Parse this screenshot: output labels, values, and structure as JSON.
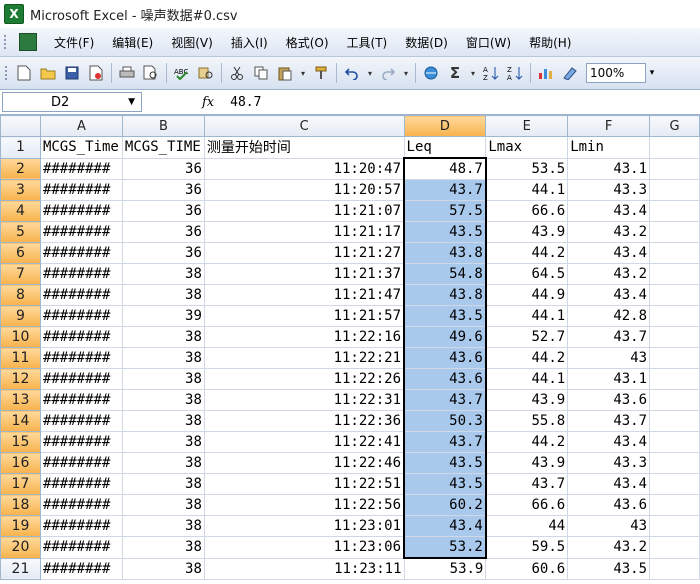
{
  "window": {
    "title": "Microsoft Excel - 噪声数据#0.csv",
    "app_icon": "excel-icon"
  },
  "menu": [
    "文件(F)",
    "编辑(E)",
    "视图(V)",
    "插入(I)",
    "格式(O)",
    "工具(T)",
    "数据(D)",
    "窗口(W)",
    "帮助(H)"
  ],
  "toolbar": {
    "zoom": "100%",
    "autosum": "Σ"
  },
  "formula": {
    "name_box": "D2",
    "fx": "fx",
    "value": "48.7"
  },
  "columns": [
    "A",
    "B",
    "C",
    "D",
    "E",
    "F",
    "G"
  ],
  "header_row": [
    "MCGS_Time",
    "MCGS_TIME",
    "测量开始时间",
    "Leq",
    "Lmax",
    "Lmin",
    ""
  ],
  "rows": [
    {
      "n": "1"
    },
    {
      "n": "2",
      "a": "########",
      "b": "36",
      "c": "11:20:47",
      "d": "48.7",
      "e": "53.5",
      "f": "43.1"
    },
    {
      "n": "3",
      "a": "########",
      "b": "36",
      "c": "11:20:57",
      "d": "43.7",
      "e": "44.1",
      "f": "43.3"
    },
    {
      "n": "4",
      "a": "########",
      "b": "36",
      "c": "11:21:07",
      "d": "57.5",
      "e": "66.6",
      "f": "43.4"
    },
    {
      "n": "5",
      "a": "########",
      "b": "36",
      "c": "11:21:17",
      "d": "43.5",
      "e": "43.9",
      "f": "43.2"
    },
    {
      "n": "6",
      "a": "########",
      "b": "36",
      "c": "11:21:27",
      "d": "43.8",
      "e": "44.2",
      "f": "43.4"
    },
    {
      "n": "7",
      "a": "########",
      "b": "38",
      "c": "11:21:37",
      "d": "54.8",
      "e": "64.5",
      "f": "43.2"
    },
    {
      "n": "8",
      "a": "########",
      "b": "38",
      "c": "11:21:47",
      "d": "43.8",
      "e": "44.9",
      "f": "43.4"
    },
    {
      "n": "9",
      "a": "########",
      "b": "39",
      "c": "11:21:57",
      "d": "43.5",
      "e": "44.1",
      "f": "42.8"
    },
    {
      "n": "10",
      "a": "########",
      "b": "38",
      "c": "11:22:16",
      "d": "49.6",
      "e": "52.7",
      "f": "43.7"
    },
    {
      "n": "11",
      "a": "########",
      "b": "38",
      "c": "11:22:21",
      "d": "43.6",
      "e": "44.2",
      "f": "43"
    },
    {
      "n": "12",
      "a": "########",
      "b": "38",
      "c": "11:22:26",
      "d": "43.6",
      "e": "44.1",
      "f": "43.1"
    },
    {
      "n": "13",
      "a": "########",
      "b": "38",
      "c": "11:22:31",
      "d": "43.7",
      "e": "43.9",
      "f": "43.6"
    },
    {
      "n": "14",
      "a": "########",
      "b": "38",
      "c": "11:22:36",
      "d": "50.3",
      "e": "55.8",
      "f": "43.7"
    },
    {
      "n": "15",
      "a": "########",
      "b": "38",
      "c": "11:22:41",
      "d": "43.7",
      "e": "44.2",
      "f": "43.4"
    },
    {
      "n": "16",
      "a": "########",
      "b": "38",
      "c": "11:22:46",
      "d": "43.5",
      "e": "43.9",
      "f": "43.3"
    },
    {
      "n": "17",
      "a": "########",
      "b": "38",
      "c": "11:22:51",
      "d": "43.5",
      "e": "43.7",
      "f": "43.4"
    },
    {
      "n": "18",
      "a": "########",
      "b": "38",
      "c": "11:22:56",
      "d": "60.2",
      "e": "66.6",
      "f": "43.6"
    },
    {
      "n": "19",
      "a": "########",
      "b": "38",
      "c": "11:23:01",
      "d": "43.4",
      "e": "44",
      "f": "43"
    },
    {
      "n": "20",
      "a": "########",
      "b": "38",
      "c": "11:23:06",
      "d": "53.2",
      "e": "59.5",
      "f": "43.2"
    },
    {
      "n": "21",
      "a": "########",
      "b": "38",
      "c": "11:23:11",
      "d": "53.9",
      "e": "60.6",
      "f": "43.5"
    }
  ]
}
